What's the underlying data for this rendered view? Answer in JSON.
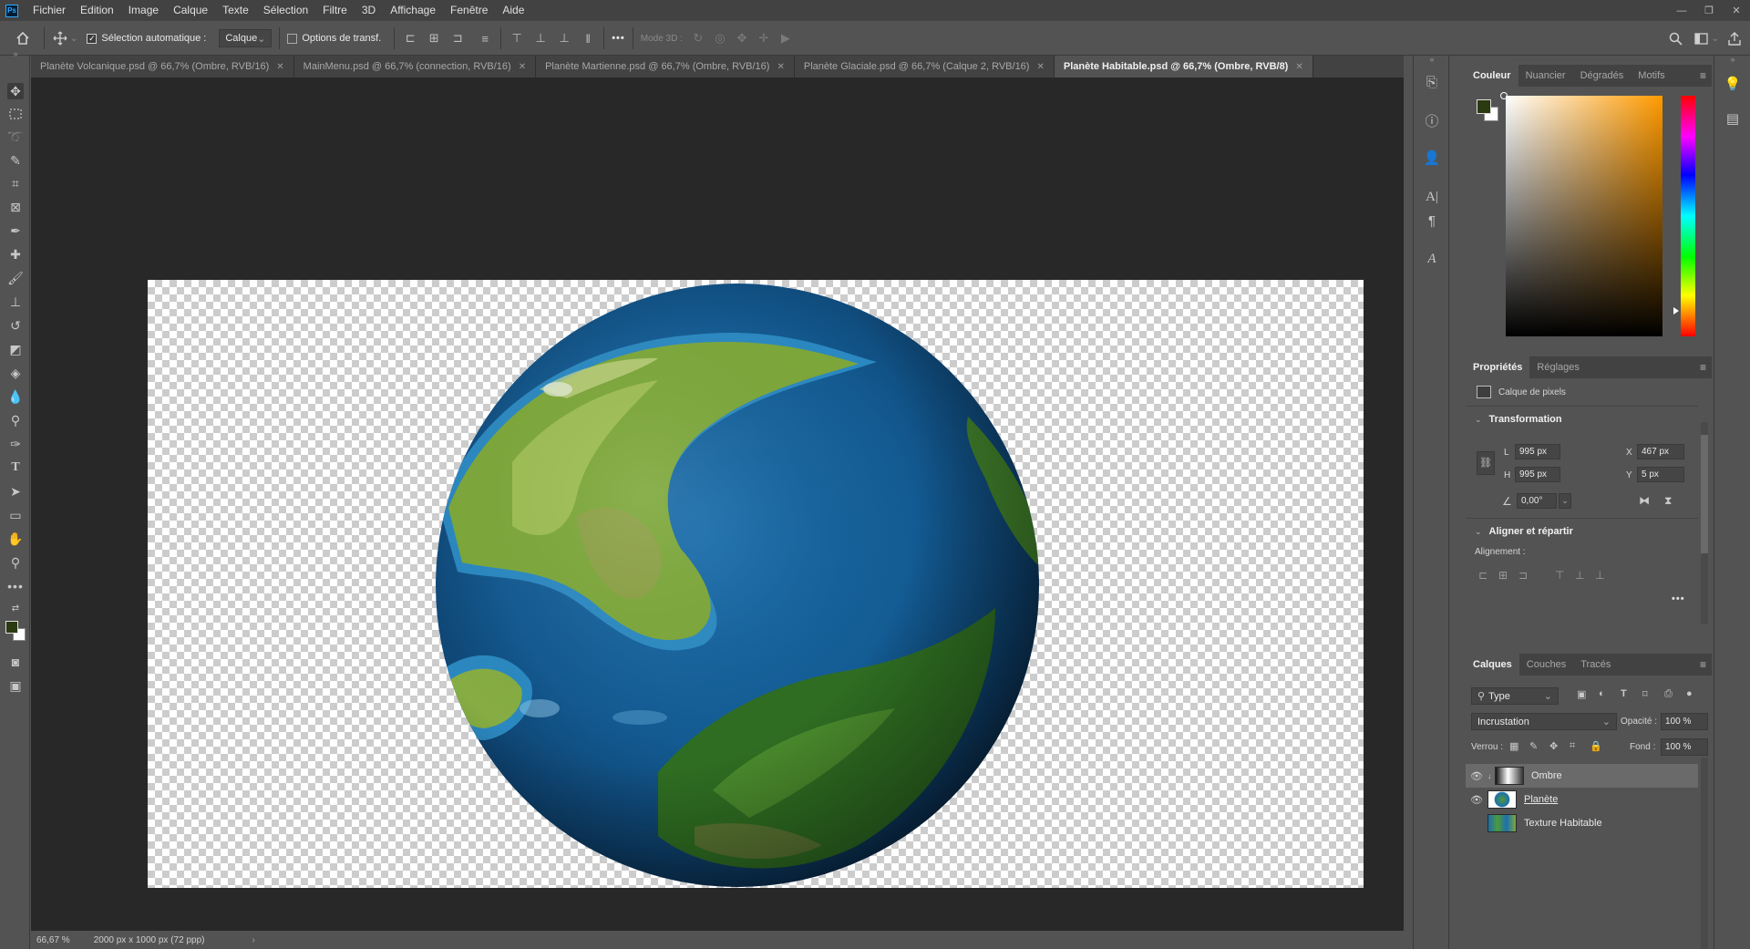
{
  "app": {
    "logo": "Ps",
    "menu": [
      "Fichier",
      "Edition",
      "Image",
      "Calque",
      "Texte",
      "Sélection",
      "Filtre",
      "3D",
      "Affichage",
      "Fenêtre",
      "Aide"
    ],
    "window_controls": [
      "—",
      "❐",
      "✕"
    ]
  },
  "options_bar": {
    "auto_select_label": "Sélection automatique :",
    "auto_select_checked": true,
    "auto_select_target": "Calque",
    "transform_options_label": "Options de transf.",
    "transform_options_checked": false,
    "more_label": "•••",
    "mode3d_label": "Mode 3D :"
  },
  "tabs": [
    {
      "label": "Planète Volcanique.psd @ 66,7% (Ombre, RVB/16)",
      "active": false
    },
    {
      "label": "MainMenu.psd @ 66,7% (connection, RVB/16)",
      "active": false
    },
    {
      "label": "Planète Martienne.psd @ 66,7% (Ombre, RVB/16)",
      "active": false
    },
    {
      "label": "Planète Glaciale.psd @ 66,7% (Calque 2, RVB/16)",
      "active": false
    },
    {
      "label": "Planète Habitable.psd @ 66,7% (Ombre, RVB/8)",
      "active": true
    }
  ],
  "status": {
    "zoom": "66,67 %",
    "doc_size": "2000 px x 1000 px (72 ppp)"
  },
  "color_panel": {
    "tabs": [
      "Couleur",
      "Nuancier",
      "Dégradés",
      "Motifs"
    ],
    "active_tab": "Couleur",
    "foreground": "#2b3a10",
    "background": "#ffffff",
    "hue_base": "#ff9a00"
  },
  "properties_panel": {
    "tabs": [
      "Propriétés",
      "Réglages"
    ],
    "active_tab": "Propriétés",
    "kind": "Calque de pixels",
    "transform_title": "Transformation",
    "w_label": "L",
    "w_value": "995 px",
    "h_label": "H",
    "h_value": "995 px",
    "x_label": "X",
    "x_value": "467 px",
    "y_label": "Y",
    "y_value": "5 px",
    "angle_value": "0,00°",
    "align_title": "Aligner et répartir",
    "align_label": "Alignement :",
    "more_label": "•••"
  },
  "layers_panel": {
    "tabs": [
      "Calques",
      "Couches",
      "Tracés"
    ],
    "active_tab": "Calques",
    "filter_kind": "Type",
    "blend_mode": "Incrustation",
    "opacity_label": "Opacité :",
    "opacity_value": "100 %",
    "lock_label": "Verrou :",
    "fill_label": "Fond :",
    "fill_value": "100 %",
    "layers": [
      {
        "name": "Ombre",
        "visible": true,
        "selected": true
      },
      {
        "name": "Planète",
        "visible": true,
        "selected": false
      },
      {
        "name": "Texture Habitable",
        "visible": false,
        "selected": false
      }
    ]
  }
}
